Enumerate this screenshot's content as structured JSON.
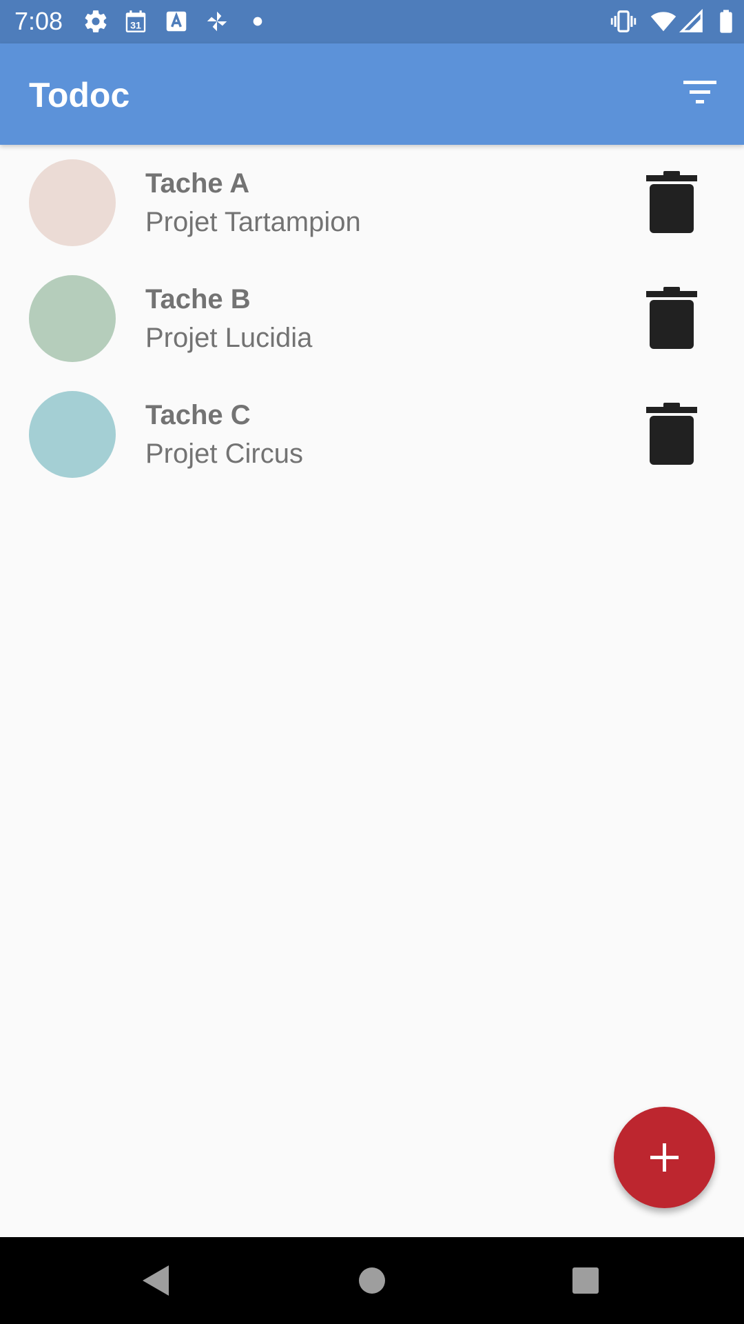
{
  "status_bar": {
    "time": "7:08",
    "left_icons": [
      "settings-icon",
      "calendar-icon",
      "text-a-icon",
      "pinwheel-icon",
      "dot-icon"
    ],
    "calendar_day": "31",
    "right_icons": [
      "vibrate-icon",
      "wifi-icon",
      "signal-icon",
      "battery-icon"
    ]
  },
  "app_bar": {
    "title": "Todoc",
    "filter_icon": "filter-icon"
  },
  "tasks": [
    {
      "name": "Tache A",
      "project": "Projet Tartampion",
      "color": "#ebdbd5"
    },
    {
      "name": "Tache B",
      "project": "Projet Lucidia",
      "color": "#b5cdbb"
    },
    {
      "name": "Tache C",
      "project": "Projet Circus",
      "color": "#a4cfd4"
    }
  ],
  "delete_icon": "trash-icon",
  "fab": {
    "icon": "plus-icon",
    "color": "#bd262f"
  },
  "colors": {
    "status_bar": "#4e7dbb",
    "app_bar": "#5c92d9",
    "background": "#fafafa",
    "task_text": "#737373"
  },
  "nav_bar": {
    "buttons": [
      "back-icon",
      "home-icon",
      "recents-icon"
    ]
  }
}
